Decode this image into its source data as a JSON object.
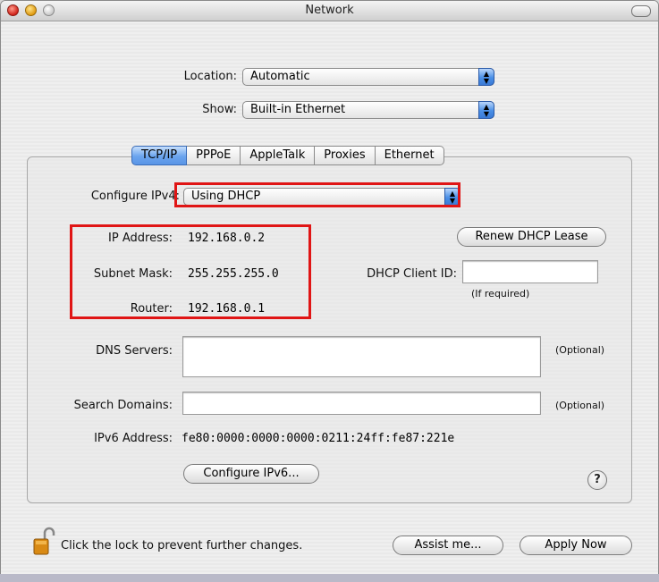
{
  "window": {
    "title": "Network"
  },
  "location": {
    "label": "Location:",
    "value": "Automatic"
  },
  "show": {
    "label": "Show:",
    "value": "Built-in Ethernet"
  },
  "tabs": [
    "TCP/IP",
    "PPPoE",
    "AppleTalk",
    "Proxies",
    "Ethernet"
  ],
  "configure_ipv4": {
    "label": "Configure IPv4:",
    "value": "Using DHCP"
  },
  "ip": {
    "address_label": "IP Address:",
    "address": "192.168.0.2",
    "subnet_label": "Subnet Mask:",
    "subnet": "255.255.255.0",
    "router_label": "Router:",
    "router": "192.168.0.1"
  },
  "renew_button": "Renew DHCP Lease",
  "dhcp_client": {
    "label": "DHCP Client ID:",
    "value": "",
    "hint": "(If required)"
  },
  "dns": {
    "label": "DNS Servers:",
    "value": "",
    "hint": "(Optional)"
  },
  "search_domains": {
    "label": "Search Domains:",
    "value": "",
    "hint": "(Optional)"
  },
  "ipv6": {
    "label": "IPv6 Address:",
    "value": "fe80:0000:0000:0000:0211:24ff:fe87:221e"
  },
  "configure_ipv6_button": "Configure IPv6...",
  "help_glyph": "?",
  "lock_text": "Click the lock to prevent further changes.",
  "assist_button": "Assist me...",
  "apply_button": "Apply Now",
  "colors": {
    "highlight_box": "#e01515",
    "accent": "#4a8fe6"
  }
}
